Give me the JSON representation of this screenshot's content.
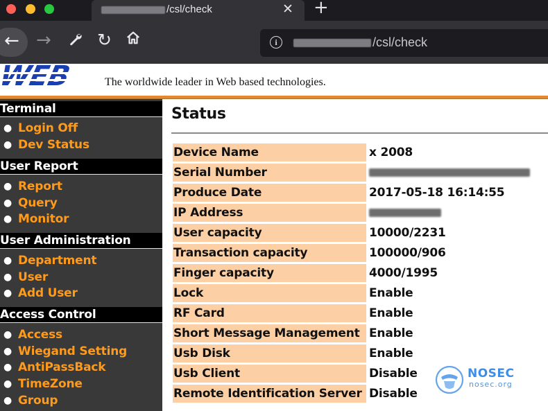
{
  "browser": {
    "tab_title": "/csl/check",
    "tab_close": "✕",
    "new_tab": "+",
    "url": "/csl/check",
    "icons": [
      "back-arrow-icon",
      "forward-arrow-icon",
      "wrench-icon",
      "reload-icon",
      "home-icon",
      "info-icon"
    ]
  },
  "header": {
    "logo_text": "WEB",
    "tagline": "The worldwide leader in Web based technologies."
  },
  "sidebar": {
    "sections": [
      {
        "title": "Terminal",
        "items": [
          "Login Off",
          "Dev Status"
        ]
      },
      {
        "title": "User Report",
        "items": [
          "Report",
          "Query",
          "Monitor"
        ]
      },
      {
        "title": "User Administration",
        "items": [
          "Department",
          "User",
          "Add User"
        ]
      },
      {
        "title": "Access Control",
        "items": [
          "Access",
          "Wiegand Setting",
          "AntiPassBack",
          "TimeZone",
          "Group"
        ]
      }
    ]
  },
  "main": {
    "title": "Status",
    "rows": [
      {
        "label": "Device Name",
        "value": "x 2008"
      },
      {
        "label": "Serial Number",
        "value": ""
      },
      {
        "label": "Produce Date",
        "value": "2017-05-18 16:14:55"
      },
      {
        "label": "IP Address",
        "value": ""
      },
      {
        "label": "User capacity",
        "value": "10000/2231"
      },
      {
        "label": "Transaction capacity",
        "value": "100000/906"
      },
      {
        "label": "Finger capacity",
        "value": "4000/1995"
      },
      {
        "label": "Lock",
        "value": "Enable"
      },
      {
        "label": "RF Card",
        "value": "Enable"
      },
      {
        "label": "Short Message Management",
        "value": "Enable"
      },
      {
        "label": "Usb Disk",
        "value": "Enable"
      },
      {
        "label": "Usb Client",
        "value": "Disable"
      },
      {
        "label": "Remote Identification Server",
        "value": "Disable"
      }
    ]
  },
  "watermark": {
    "name": "NOSEC",
    "domain": "nosec.org"
  },
  "colors": {
    "menu_link": "#ff9a1a",
    "label_bg": "#fcd0a4",
    "sidebar_bg": "#393939",
    "logo_blue": "#1a3fb0",
    "watermark_blue": "#3f8ee6"
  }
}
